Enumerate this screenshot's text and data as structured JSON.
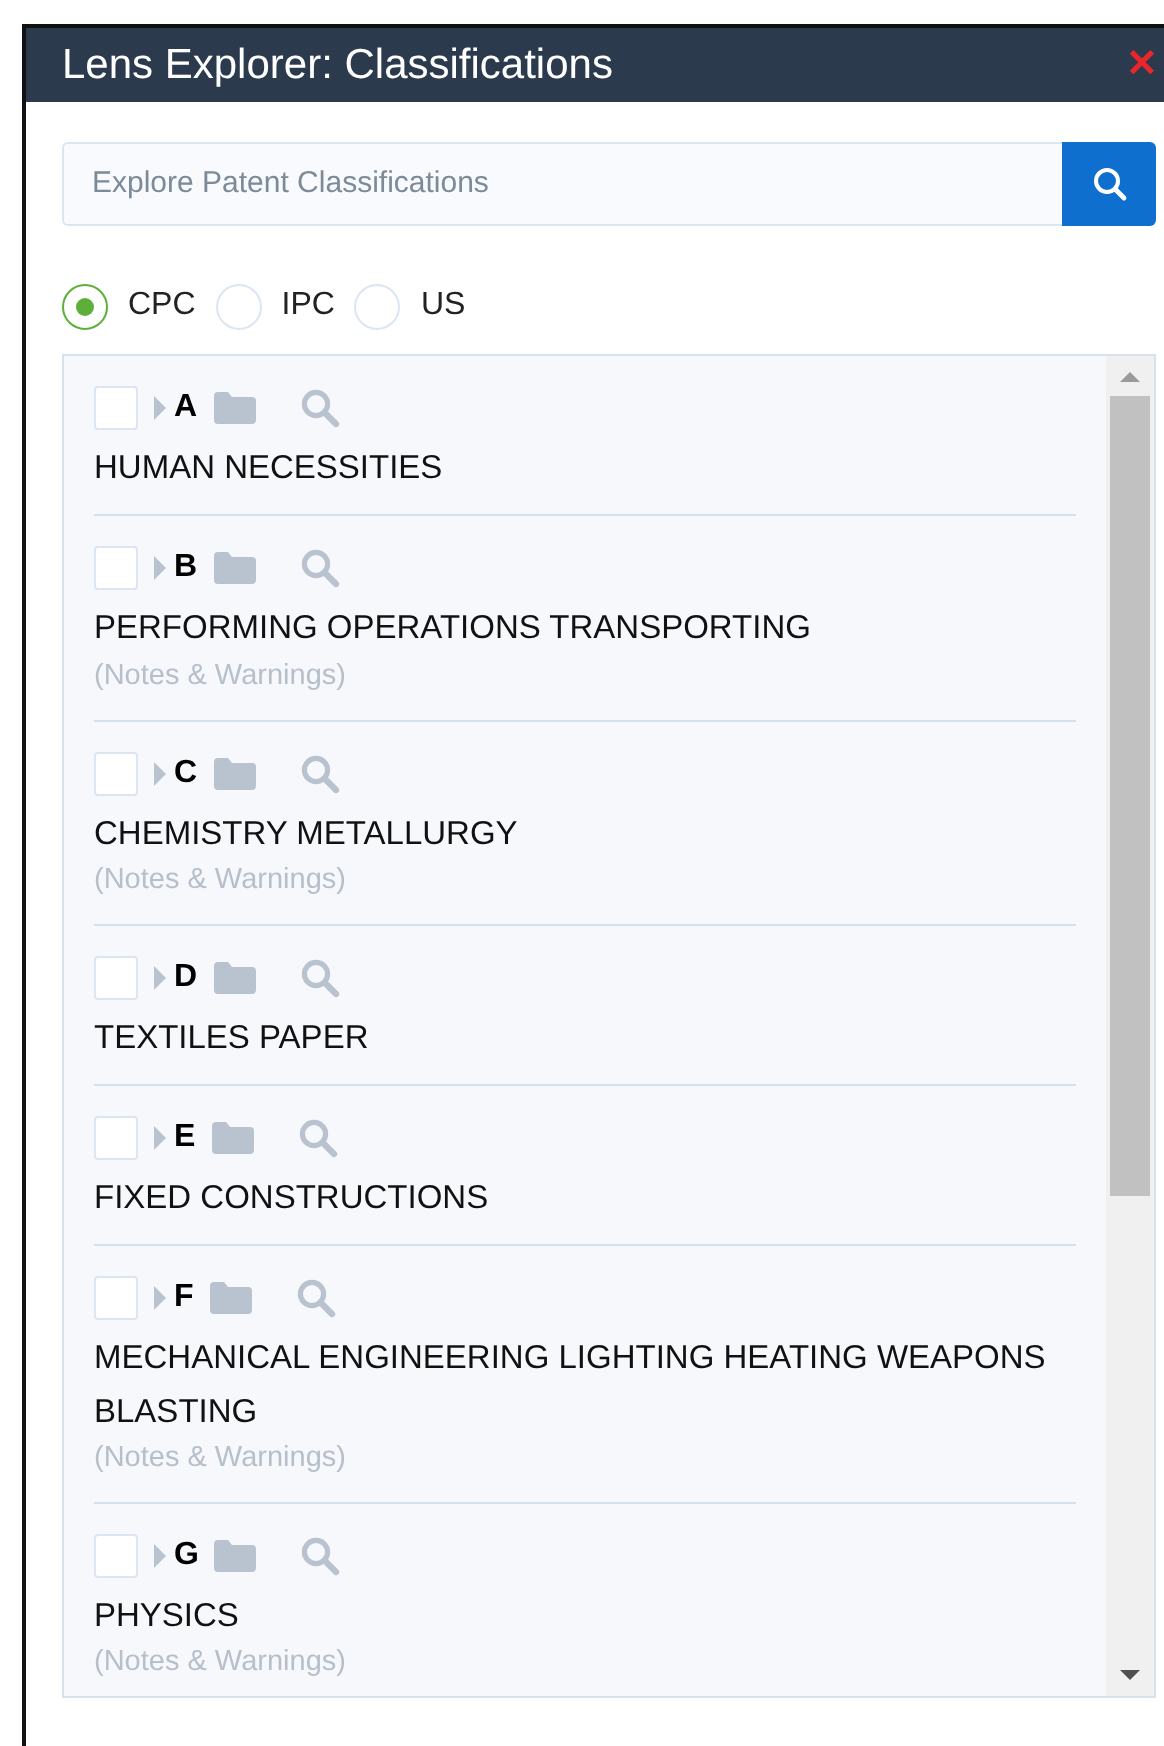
{
  "window": {
    "title": "Lens Explorer: Classifications",
    "close": "✕"
  },
  "search": {
    "placeholder": "Explore Patent Classifications"
  },
  "schemes": [
    {
      "label": "CPC",
      "selected": true
    },
    {
      "label": "IPC",
      "selected": false
    },
    {
      "label": "US",
      "selected": false
    }
  ],
  "classes": [
    {
      "code": "A",
      "title": "HUMAN NECESSITIES",
      "checked": false
    },
    {
      "code": "B",
      "title": "PERFORMING OPERATIONS TRANSPORTING",
      "notes": "(Notes & Warnings)",
      "checked": false
    },
    {
      "code": "C",
      "title": "CHEMISTRY METALLURGY",
      "notes": "(Notes & Warnings)",
      "checked": false
    },
    {
      "code": "D",
      "title": "TEXTILES PAPER",
      "checked": false
    },
    {
      "code": "E",
      "title": "FIXED CONSTRUCTIONS",
      "checked": false
    },
    {
      "code": "F",
      "title": "MECHANICAL ENGINEERING LIGHTING HEATING WEAPONS BLASTING",
      "notes": "(Notes & Warnings)",
      "checked": false
    },
    {
      "code": "G",
      "title": "PHYSICS",
      "notes": "(Notes & Warnings)",
      "checked": false
    }
  ]
}
